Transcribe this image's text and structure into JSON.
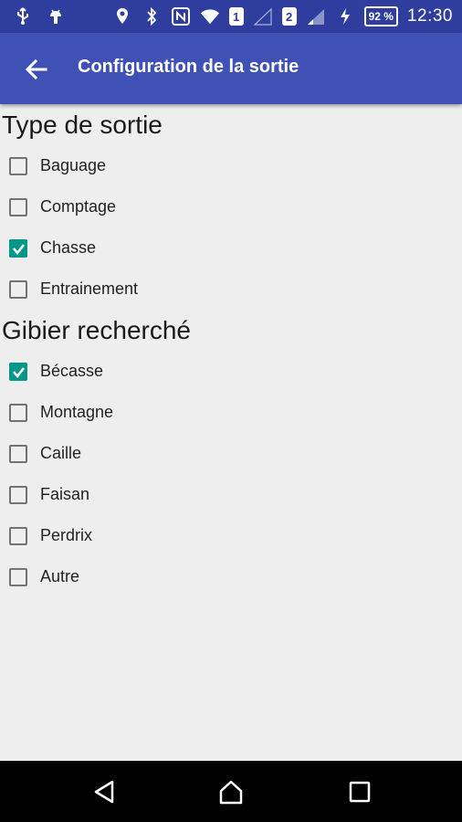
{
  "status_bar": {
    "sim1": "1",
    "sim2": "2",
    "battery": "92 %",
    "time": "12:30",
    "icons": [
      "usb-icon",
      "android-debug-icon",
      "location-icon",
      "bluetooth-icon",
      "nfc-icon",
      "wifi-icon",
      "signal-icon",
      "charging-icon"
    ]
  },
  "app_bar": {
    "title": "Configuration de la sortie"
  },
  "sections": {
    "type": {
      "title": "Type de sortie",
      "items": [
        {
          "label": "Baguage",
          "checked": false
        },
        {
          "label": "Comptage",
          "checked": false
        },
        {
          "label": "Chasse",
          "checked": true
        },
        {
          "label": "Entrainement",
          "checked": false
        }
      ]
    },
    "gibier": {
      "title": "Gibier recherché",
      "items": [
        {
          "label": "Bécasse",
          "checked": true
        },
        {
          "label": "Montagne",
          "checked": false
        },
        {
          "label": "Caille",
          "checked": false
        },
        {
          "label": "Faisan",
          "checked": false
        },
        {
          "label": "Perdrix",
          "checked": false
        },
        {
          "label": "Autre",
          "checked": false
        }
      ]
    }
  },
  "colors": {
    "status_bar": "#2f3e9e",
    "app_bar": "#3f51b5",
    "accent": "#009688",
    "background": "#eeeeee"
  }
}
